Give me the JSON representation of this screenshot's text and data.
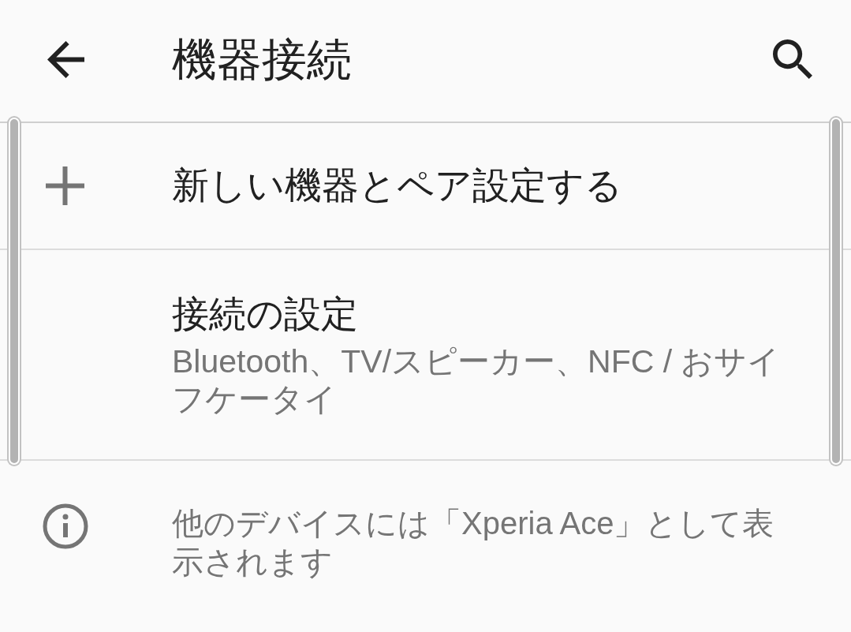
{
  "app_bar": {
    "title": "機器接続"
  },
  "section": {
    "highlighted": true,
    "items": [
      {
        "kind": "action",
        "title": "新しい機器とペア設定する"
      },
      {
        "kind": "setting",
        "title": "接続の設定",
        "summary": "Bluetooth、TV/スピーカー、NFC / おサイフケータイ"
      }
    ]
  },
  "footer": {
    "text": "他のデバイスには「Xperia Ace」として表示されます"
  }
}
